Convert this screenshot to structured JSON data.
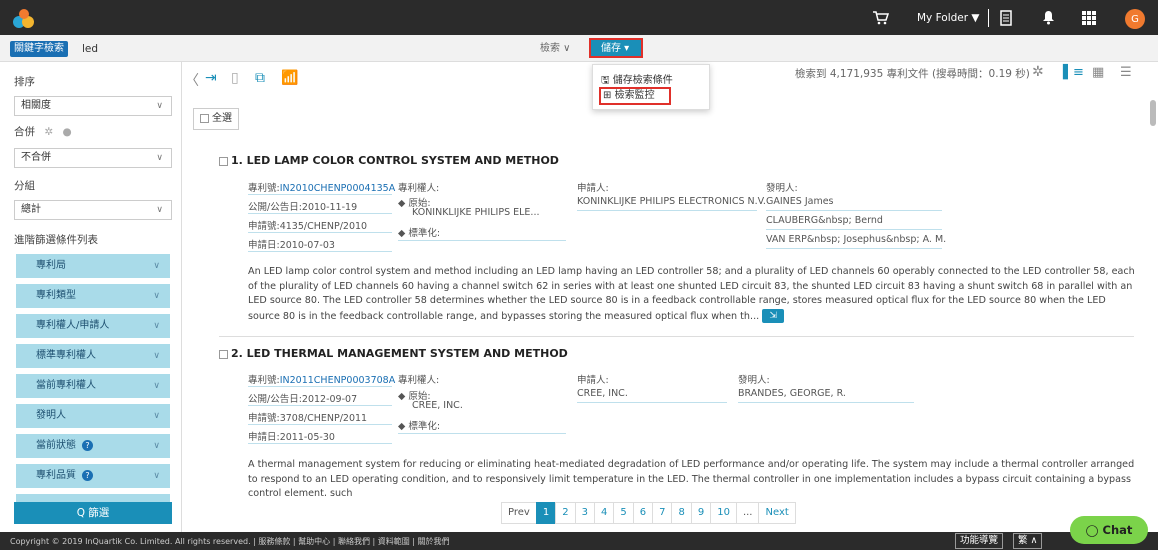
{
  "topbar": {
    "folder_label": "My Folder ▼",
    "avatar_letter": "G"
  },
  "search": {
    "keyword_tag": "關鍵字檢索",
    "keyword": "led",
    "search_label": "檢索 ∨",
    "save_label": "儲存 ▾"
  },
  "dropdown": {
    "save_conditions": "儲存檢索條件",
    "monitor": "檢索監控"
  },
  "sidebar": {
    "sort_label": "排序",
    "sort_value": "相關度",
    "merge_label": "合併",
    "merge_value": "不合併",
    "group_label": "分組",
    "group_value": "總計",
    "advanced_label": "進階篩選條件列表",
    "facets": [
      {
        "label": "專利局",
        "help": ""
      },
      {
        "label": "專利類型",
        "help": ""
      },
      {
        "label": "專利權人/申請人",
        "help": ""
      },
      {
        "label": "標準專利權人",
        "help": ""
      },
      {
        "label": "當前專利權人",
        "help": ""
      },
      {
        "label": "發明人",
        "help": ""
      },
      {
        "label": "當前狀態",
        "help": "?"
      },
      {
        "label": "專利品質",
        "help": "?"
      }
    ],
    "filter_button": "Q 篩選"
  },
  "results_header": {
    "count_text": "檢索到 4,171,935 專利文件 (搜尋時間：0.19 秒)",
    "select_all": "全選"
  },
  "results": [
    {
      "title": "1. LED LAMP COLOR CONTROL SYSTEM AND METHOD",
      "patent_no_label": "專利號:",
      "patent_no": "IN2010CHENP0004135A",
      "pub_date": "公開/公告日:2010-11-19",
      "app_no": "申請號:4135/CHENP/2010",
      "app_date": "申請日:2010-07-03",
      "assignee_label": "專利權人:",
      "original_label": "◆ 原始:",
      "original": "KONINKLIJKE PHILIPS ELE...",
      "standard_label": "◆ 標準化:",
      "applicant_label": "申請人:",
      "applicant": "KONINKLIJKE PHILIPS ELECTRONICS N.V.",
      "inventor_label": "發明人:",
      "inventors": [
        "GAINES James",
        "CLAUBERG&nbsp; Bernd",
        "VAN ERP&nbsp; Josephus&nbsp; A. M."
      ],
      "abstract": "An LED lamp color control system and method including an LED lamp having an LED controller 58; and a plurality of LED channels 60 operably connected to the LED controller 58, each of the plurality of LED channels 60 having a channel switch 62 in series with at least one shunted LED circuit 83, the shunted LED circuit 83 having a shunt switch 68 in parallel with an LED source 80. The LED controller 58 determines whether the LED source 80 is in a feedback controllable range, stores measured optical flux for the LED source 80 when the LED source 80 is in the feedback controllable range, and bypasses storing the measured optical flux when th..."
    },
    {
      "title": "2. LED THERMAL MANAGEMENT SYSTEM AND METHOD",
      "patent_no_label": "專利號:",
      "patent_no": "IN2011CHENP0003708A",
      "pub_date": "公開/公告日:2012-09-07",
      "app_no": "申請號:3708/CHENP/2011",
      "app_date": "申請日:2011-05-30",
      "assignee_label": "專利權人:",
      "original_label": "◆ 原始:",
      "original": "CREE, INC.",
      "standard_label": "◆ 標準化:",
      "applicant_label": "申請人:",
      "applicant": "CREE, INC.",
      "inventor_label": "發明人:",
      "inventors": [
        "BRANDES, GEORGE, R."
      ],
      "abstract": "A thermal management system for reducing or eliminating heat-mediated degradation of LED performance and/or operating life. The system may include a thermal controller arranged to respond to an LED operating condition, and to responsively limit temperature in the LED. The thermal controller in one implementation includes a bypass circuit containing a bypass control element, such"
    }
  ],
  "pager": {
    "prev": "Prev",
    "pages": [
      "1",
      "2",
      "3",
      "4",
      "5",
      "6",
      "7",
      "8",
      "9",
      "10",
      "..."
    ],
    "next": "Next"
  },
  "footer": {
    "copyright": "Copyright © 2019 InQuartik Co. Limited. All rights reserved. | 服務條款 | 幫助中心 | 聯絡我們 | 資料範圍 | 關於我們",
    "guide": "功能導覽",
    "lang": "繁 ∧",
    "chat": "Chat"
  },
  "colors": {
    "accent": "#1a8fb8",
    "highlight": "#e0302a",
    "facet_bg": "#a9dbe9",
    "chat_bg": "#7bd34a"
  }
}
